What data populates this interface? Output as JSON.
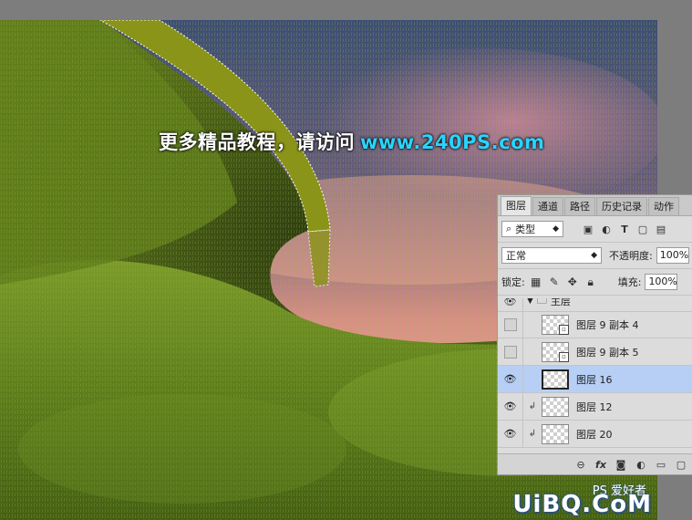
{
  "watermark": {
    "top_text": "更多精品教程，请访问",
    "top_url": "www.240PS.com",
    "bottom_small": "PS 爱好者",
    "bottom_logo": "UiBQ.CoM"
  },
  "panel": {
    "tabs": [
      {
        "label": "图层",
        "active": true
      },
      {
        "label": "通道",
        "active": false
      },
      {
        "label": "路径",
        "active": false
      },
      {
        "label": "历史记录",
        "active": false
      },
      {
        "label": "动作",
        "active": false
      }
    ],
    "filter_label": "类型",
    "filter_prefix": "⌕",
    "blend_mode": "正常",
    "opacity_label": "不透明度:",
    "opacity_value": "100%",
    "lock_label": "锁定:",
    "fill_label": "填充:",
    "fill_value": "100%",
    "group_name": "主层",
    "layers": [
      {
        "name": "图层 9 副本 4",
        "visible": false,
        "clipped": false,
        "smart": true,
        "selected": false
      },
      {
        "name": "图层 9 副本 5",
        "visible": false,
        "clipped": false,
        "smart": true,
        "selected": false
      },
      {
        "name": "图层 16",
        "visible": true,
        "clipped": false,
        "smart": false,
        "selected": true
      },
      {
        "name": "图层 12",
        "visible": true,
        "clipped": true,
        "smart": false,
        "selected": false
      },
      {
        "name": "图层 20",
        "visible": true,
        "clipped": true,
        "smart": false,
        "selected": false
      }
    ],
    "bottom_icons": [
      "link-icon",
      "fx-icon",
      "mask-icon",
      "adjustment-icon",
      "folder-icon",
      "new-layer-icon"
    ]
  }
}
